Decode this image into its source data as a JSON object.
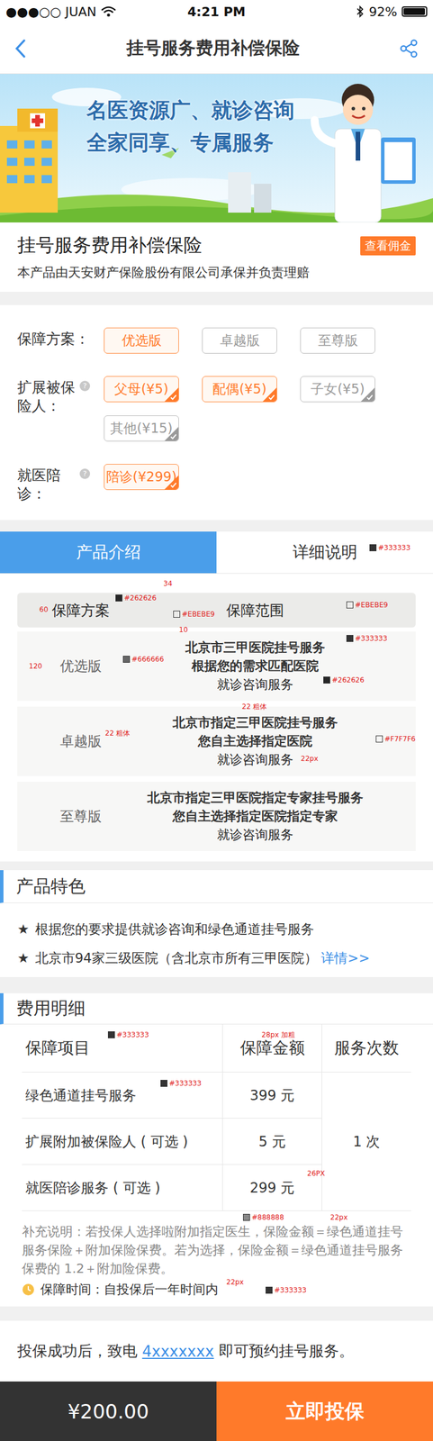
{
  "status_bar": {
    "carrier": "●●●○○ JUAN",
    "time": "4:21 PM",
    "battery": "92%",
    "battery_level": 0.92
  },
  "nav": {
    "title": "挂号服务费用补偿保险"
  },
  "banner": {
    "lines": [
      "名医资源广、就诊咨询",
      "全家同享、专属服务"
    ]
  },
  "product": {
    "title": "挂号服务费用补偿保险",
    "badge": "查看佣金",
    "subtitle": "本产品由天安财产保险股份有限公司承保并负责理赔"
  },
  "option_groups": [
    {
      "label": "保障方案：",
      "help": "",
      "kind": "plain",
      "options": [
        {
          "label": "优选版",
          "selected": true
        },
        {
          "label": "卓越版",
          "selected": false
        },
        {
          "label": "至尊版",
          "selected": false
        }
      ]
    },
    {
      "label": "扩展被保险人：",
      "help": "?",
      "kind": "check",
      "options": [
        {
          "label": "父母(¥5)",
          "selected": true
        },
        {
          "label": "配偶(¥5)",
          "selected": true
        },
        {
          "label": "子女(¥5)",
          "selected": false
        },
        {
          "label": "其他(¥15)",
          "selected": false
        }
      ]
    },
    {
      "label": "就医陪诊：",
      "help": "?",
      "kind": "check",
      "options": [
        {
          "label": "陪诊(¥299)",
          "selected": true
        }
      ]
    }
  ],
  "tabs": [
    {
      "label": "产品介绍",
      "selected": true
    },
    {
      "label": "详细说明",
      "selected": false
    }
  ],
  "coverage_table": {
    "columns": [
      "保障方案",
      "保障范围"
    ],
    "rows": [
      {
        "plan": "优选版",
        "lines": [
          "北京市三甲医院挂号服务",
          "根据您的需求匹配医院",
          "就诊咨询服务"
        ]
      },
      {
        "plan": "卓越版",
        "lines": [
          "北京市指定三甲医院挂号服务",
          "您自主选择指定医院",
          "就诊咨询服务"
        ]
      },
      {
        "plan": "至尊版",
        "lines": [
          "北京市指定三甲医院指定专家挂号服务",
          "您自主选择指定医院指定专家",
          "就诊咨询服务"
        ]
      }
    ]
  },
  "features": {
    "title": "产品特色",
    "items": [
      {
        "star": "★",
        "text": "根据您的要求提供就诊咨询和绿色通道挂号服务",
        "link": ""
      },
      {
        "star": "★",
        "text": "北京市94家三级医院（含北京市所有三甲医院）",
        "link": "详情>>"
      }
    ]
  },
  "costs": {
    "title": "费用明细",
    "columns": [
      "保障项目",
      "保障金额",
      "服务次数"
    ],
    "rows": [
      {
        "item": "绿色通道挂号服务",
        "amount": "399 元"
      },
      {
        "item": "扩展附加被保险人 ( 可选 )",
        "amount": "5 元"
      },
      {
        "item": "就医陪诊服务 ( 可选 )",
        "amount": "299 元"
      }
    ],
    "count": "1 次",
    "note": "补充说明：若投保人选择啦附加指定医生，保险金额＝绿色通道挂号服务保险＋附加保险保费。若为选择，保险金额＝绿色通道挂号服务保费的 1.2＋附加险保费。",
    "period": "保障时间：自投保后一年时间内"
  },
  "contact": {
    "before": "投保成功后，致电 ",
    "phone": "4xxxxxxx",
    "after": " 即可预约挂号服务。"
  },
  "footer": {
    "price": "¥200.00",
    "button": "立即投保"
  },
  "annotations": [
    {
      "text": "#333333",
      "kind": "swatch"
    },
    {
      "text": "34",
      "kind": "size"
    },
    {
      "text": "60",
      "kind": "size"
    },
    {
      "text": "#262626",
      "kind": "swatch"
    },
    {
      "text": "#EBEBE9",
      "kind": "swatch"
    },
    {
      "text": "#EBEBE9",
      "kind": "swatch"
    },
    {
      "text": "10",
      "kind": "size"
    },
    {
      "text": "#333333",
      "kind": "swatch"
    },
    {
      "text": "120",
      "kind": "size"
    },
    {
      "text": "#666666",
      "kind": "swatch"
    },
    {
      "text": "#262626",
      "kind": "swatch"
    },
    {
      "text": "22 粗体",
      "kind": "size"
    },
    {
      "text": "22 粗体",
      "kind": "size"
    },
    {
      "text": "#F7F7F6",
      "kind": "swatch"
    },
    {
      "text": "22px",
      "kind": "size"
    },
    {
      "text": "#333333",
      "kind": "swatch"
    },
    {
      "text": "28px 加粗",
      "kind": "size"
    },
    {
      "text": "#333333",
      "kind": "swatch"
    },
    {
      "text": "26PX",
      "kind": "size"
    },
    {
      "text": "#888888",
      "kind": "swatch"
    },
    {
      "text": "22px",
      "kind": "size"
    },
    {
      "text": "22px",
      "kind": "size"
    },
    {
      "text": "#333333",
      "kind": "swatch"
    }
  ]
}
